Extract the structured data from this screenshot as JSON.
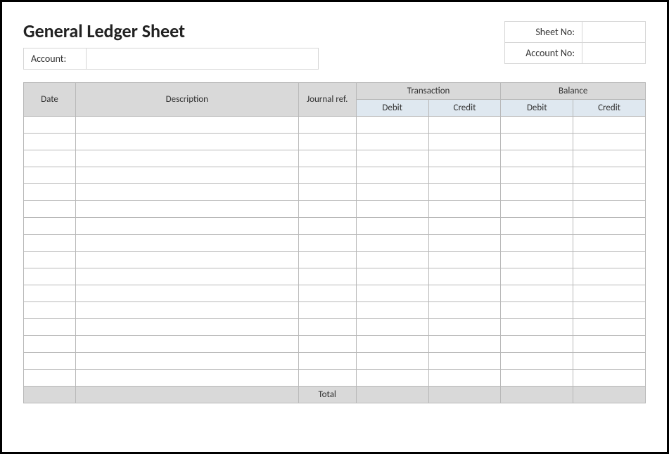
{
  "title": "General Ledger Sheet",
  "fields": {
    "account_label": "Account:",
    "account_value": "",
    "sheet_no_label": "Sheet No:",
    "sheet_no_value": "",
    "account_no_label": "Account No:",
    "account_no_value": ""
  },
  "columns": {
    "date": "Date",
    "description": "Description",
    "journal_ref": "Journal ref.",
    "transaction": "Transaction",
    "balance": "Balance",
    "debit": "Debit",
    "credit": "Credit"
  },
  "rows": [
    {
      "date": "",
      "description": "",
      "journal_ref": "",
      "t_debit": "",
      "t_credit": "",
      "b_debit": "",
      "b_credit": ""
    },
    {
      "date": "",
      "description": "",
      "journal_ref": "",
      "t_debit": "",
      "t_credit": "",
      "b_debit": "",
      "b_credit": ""
    },
    {
      "date": "",
      "description": "",
      "journal_ref": "",
      "t_debit": "",
      "t_credit": "",
      "b_debit": "",
      "b_credit": ""
    },
    {
      "date": "",
      "description": "",
      "journal_ref": "",
      "t_debit": "",
      "t_credit": "",
      "b_debit": "",
      "b_credit": ""
    },
    {
      "date": "",
      "description": "",
      "journal_ref": "",
      "t_debit": "",
      "t_credit": "",
      "b_debit": "",
      "b_credit": ""
    },
    {
      "date": "",
      "description": "",
      "journal_ref": "",
      "t_debit": "",
      "t_credit": "",
      "b_debit": "",
      "b_credit": ""
    },
    {
      "date": "",
      "description": "",
      "journal_ref": "",
      "t_debit": "",
      "t_credit": "",
      "b_debit": "",
      "b_credit": ""
    },
    {
      "date": "",
      "description": "",
      "journal_ref": "",
      "t_debit": "",
      "t_credit": "",
      "b_debit": "",
      "b_credit": ""
    },
    {
      "date": "",
      "description": "",
      "journal_ref": "",
      "t_debit": "",
      "t_credit": "",
      "b_debit": "",
      "b_credit": ""
    },
    {
      "date": "",
      "description": "",
      "journal_ref": "",
      "t_debit": "",
      "t_credit": "",
      "b_debit": "",
      "b_credit": ""
    },
    {
      "date": "",
      "description": "",
      "journal_ref": "",
      "t_debit": "",
      "t_credit": "",
      "b_debit": "",
      "b_credit": ""
    },
    {
      "date": "",
      "description": "",
      "journal_ref": "",
      "t_debit": "",
      "t_credit": "",
      "b_debit": "",
      "b_credit": ""
    },
    {
      "date": "",
      "description": "",
      "journal_ref": "",
      "t_debit": "",
      "t_credit": "",
      "b_debit": "",
      "b_credit": ""
    },
    {
      "date": "",
      "description": "",
      "journal_ref": "",
      "t_debit": "",
      "t_credit": "",
      "b_debit": "",
      "b_credit": ""
    },
    {
      "date": "",
      "description": "",
      "journal_ref": "",
      "t_debit": "",
      "t_credit": "",
      "b_debit": "",
      "b_credit": ""
    },
    {
      "date": "",
      "description": "",
      "journal_ref": "",
      "t_debit": "",
      "t_credit": "",
      "b_debit": "",
      "b_credit": ""
    }
  ],
  "footer": {
    "total_label": "Total",
    "t_debit": "",
    "t_credit": "",
    "b_debit": "",
    "b_credit": ""
  }
}
